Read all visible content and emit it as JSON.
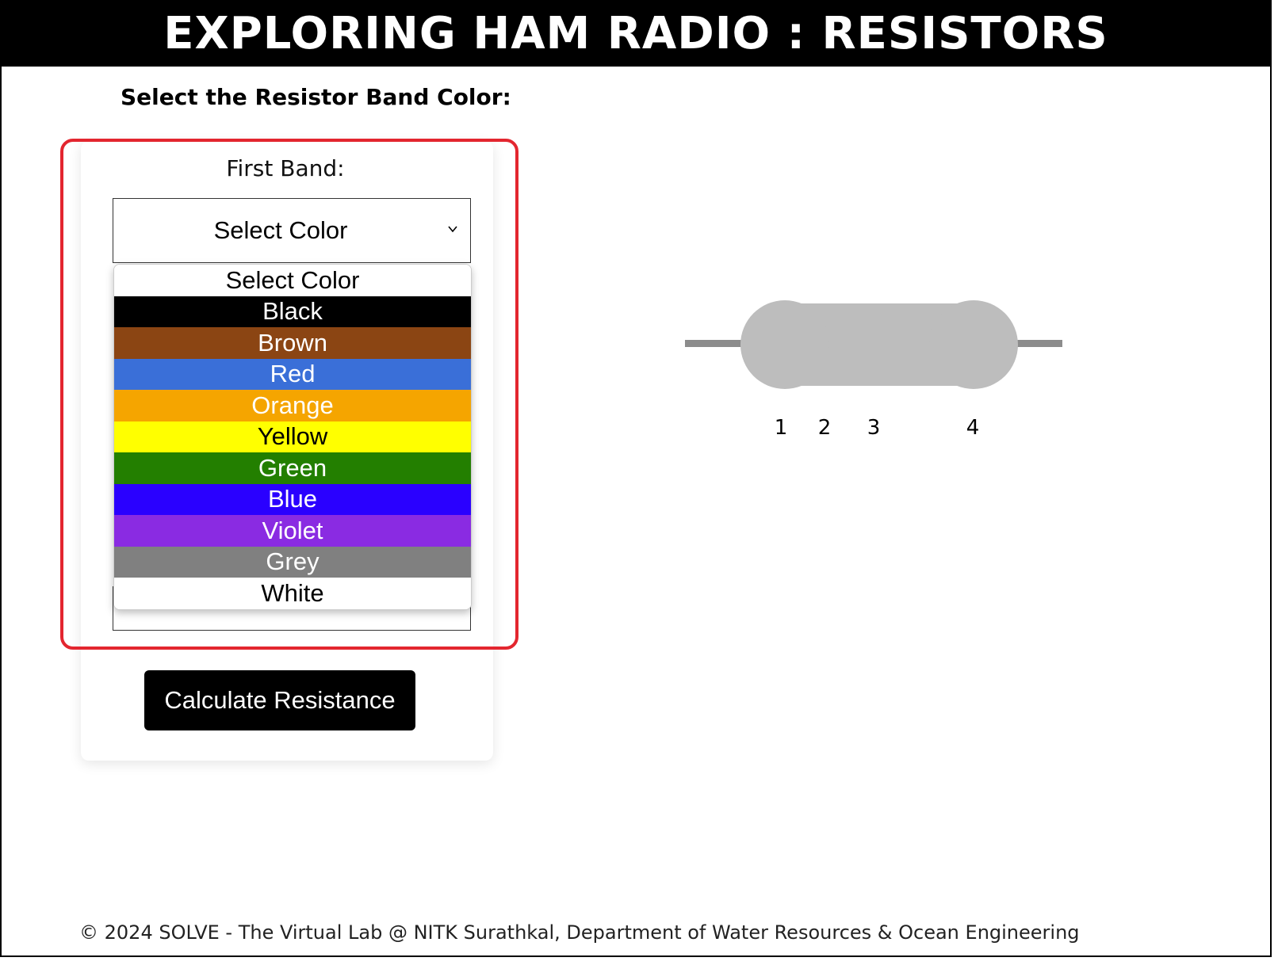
{
  "header": {
    "title": "EXPLORING HAM RADIO : RESISTORS"
  },
  "main": {
    "subtitle": "Select the Resistor Band Color:",
    "band_label": "First Band:",
    "select_value": "Select Color",
    "options": [
      {
        "label": "Select Color",
        "bg": "#ffffff",
        "fg": "#000000"
      },
      {
        "label": "Black",
        "bg": "#000000",
        "fg": "#ffffff"
      },
      {
        "label": "Brown",
        "bg": "#8b4513",
        "fg": "#ffffff"
      },
      {
        "label": "Red",
        "bg": "#3a6fd8",
        "fg": "#ffffff"
      },
      {
        "label": "Orange",
        "bg": "#f5a500",
        "fg": "#ffffff"
      },
      {
        "label": "Yellow",
        "bg": "#ffff00",
        "fg": "#000000"
      },
      {
        "label": "Green",
        "bg": "#237f00",
        "fg": "#ffffff"
      },
      {
        "label": "Blue",
        "bg": "#2a00ff",
        "fg": "#ffffff"
      },
      {
        "label": "Violet",
        "bg": "#8a2be2",
        "fg": "#ffffff"
      },
      {
        "label": "Grey",
        "bg": "#808080",
        "fg": "#ffffff"
      },
      {
        "label": "White",
        "bg": "#ffffff",
        "fg": "#000000"
      }
    ],
    "calculate_label": "Calculate Resistance"
  },
  "resistor": {
    "band_numbers": [
      "1",
      "2",
      "3",
      "4"
    ],
    "body_color": "#bdbdbd",
    "lead_color": "#8c8c8c"
  },
  "footer": {
    "text": "© 2024 SOLVE - The Virtual Lab @ NITK Surathkal, Department of Water Resources & Ocean Engineering"
  },
  "colors": {
    "highlight": "#e3262f"
  }
}
